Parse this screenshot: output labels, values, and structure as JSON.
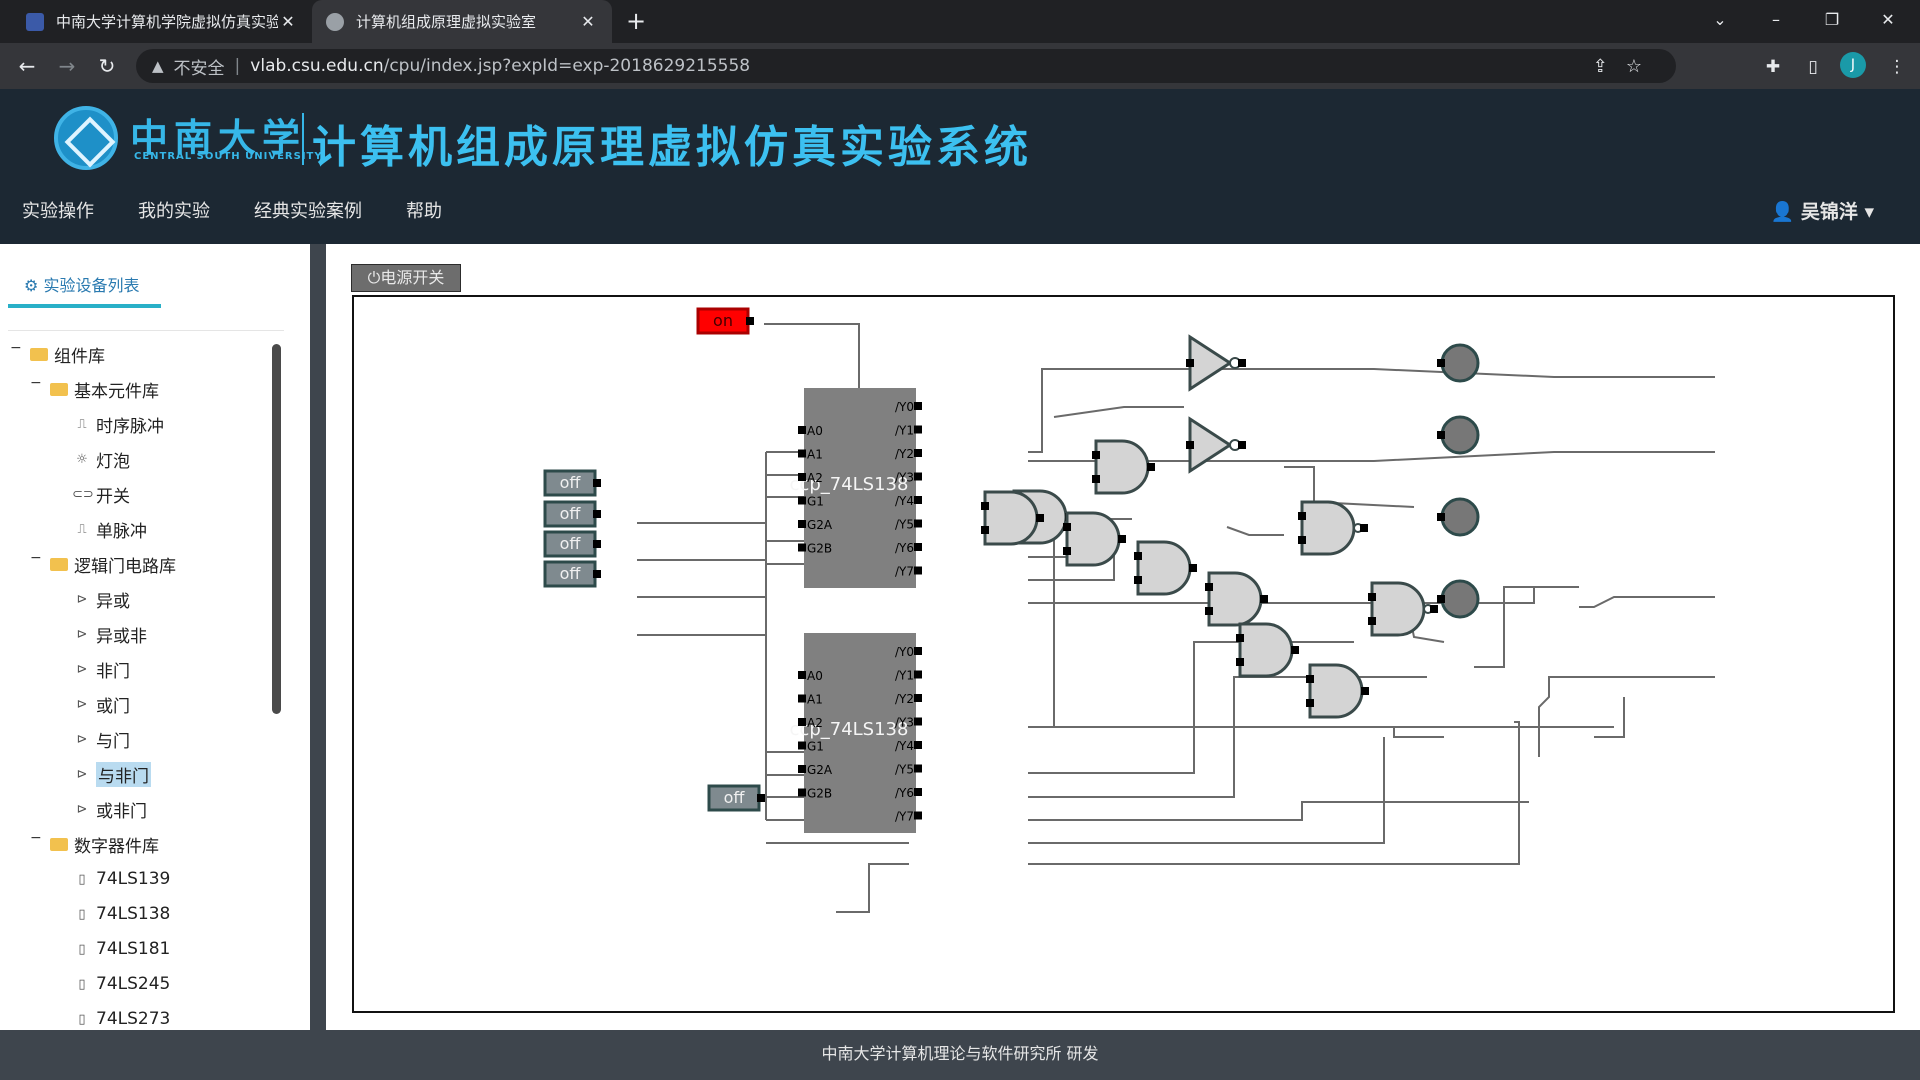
{
  "browser": {
    "tabs": [
      {
        "title": "中南大学计算机学院虚拟仿真实验",
        "active": false
      },
      {
        "title": "计算机组成原理虚拟实验室",
        "active": true
      }
    ],
    "address": {
      "security": "不安全",
      "host": "vlab.csu.edu.cn",
      "path": "/cpu/index.jsp?expId=exp-2018629215558"
    },
    "profile_initial": "J"
  },
  "site": {
    "logo_cn": "中南大学",
    "logo_en": "CENTRAL SOUTH UNIVERSITY",
    "title": "计算机组成原理虚拟仿真实验系统",
    "nav": [
      "实验操作",
      "我的实验",
      "经典实验案例",
      "帮助"
    ],
    "user": "吴锦洋"
  },
  "sidebar": {
    "tab_label": "实验设备列表",
    "tree": [
      {
        "label": "组件库",
        "level": 0,
        "type": "folder"
      },
      {
        "label": "基本元件库",
        "level": 1,
        "type": "folder"
      },
      {
        "label": "时序脉冲",
        "level": 2,
        "icon": "pulse-icon"
      },
      {
        "label": "灯泡",
        "level": 2,
        "icon": "bulb-icon"
      },
      {
        "label": "开关",
        "level": 2,
        "icon": "switch-icon"
      },
      {
        "label": "单脉冲",
        "level": 2,
        "icon": "pulse-icon"
      },
      {
        "label": "逻辑门电路库",
        "level": 1,
        "type": "folder"
      },
      {
        "label": "异或",
        "level": 2,
        "icon": "gate-icon"
      },
      {
        "label": "异或非",
        "level": 2,
        "icon": "gate-icon"
      },
      {
        "label": "非门",
        "level": 2,
        "icon": "gate-icon"
      },
      {
        "label": "或门",
        "level": 2,
        "icon": "gate-icon"
      },
      {
        "label": "与门",
        "level": 2,
        "icon": "gate-icon"
      },
      {
        "label": "与非门",
        "level": 2,
        "icon": "gate-icon",
        "selected": true
      },
      {
        "label": "或非门",
        "level": 2,
        "icon": "gate-icon"
      },
      {
        "label": "数字器件库",
        "level": 1,
        "type": "folder"
      },
      {
        "label": "74LS139",
        "level": 2,
        "icon": "chip-icon"
      },
      {
        "label": "74LS138",
        "level": 2,
        "icon": "chip-icon"
      },
      {
        "label": "74LS181",
        "level": 2,
        "icon": "chip-icon"
      },
      {
        "label": "74LS245",
        "level": 2,
        "icon": "chip-icon"
      },
      {
        "label": "74LS273",
        "level": 2,
        "icon": "chip-icon"
      }
    ]
  },
  "workspace": {
    "power_label": "电源开关",
    "switches": {
      "on": "on",
      "off": "off"
    },
    "chip_label": "ccp_74LS138",
    "inputs": [
      "A0",
      "A1",
      "A2",
      "G1",
      "G2A",
      "G2B"
    ],
    "outputs": [
      "/Y0",
      "/Y1",
      "/Y2",
      "/Y3",
      "/Y4",
      "/Y5",
      "/Y6",
      "/Y7"
    ]
  },
  "colors": {
    "wire": "#6a6a6a",
    "chip": "#808080",
    "gate": "#d4d4d4",
    "switch_on": "#ff0000",
    "lamp": "#777777"
  },
  "footer": "中南大学计算机理论与软件研究所 研发"
}
